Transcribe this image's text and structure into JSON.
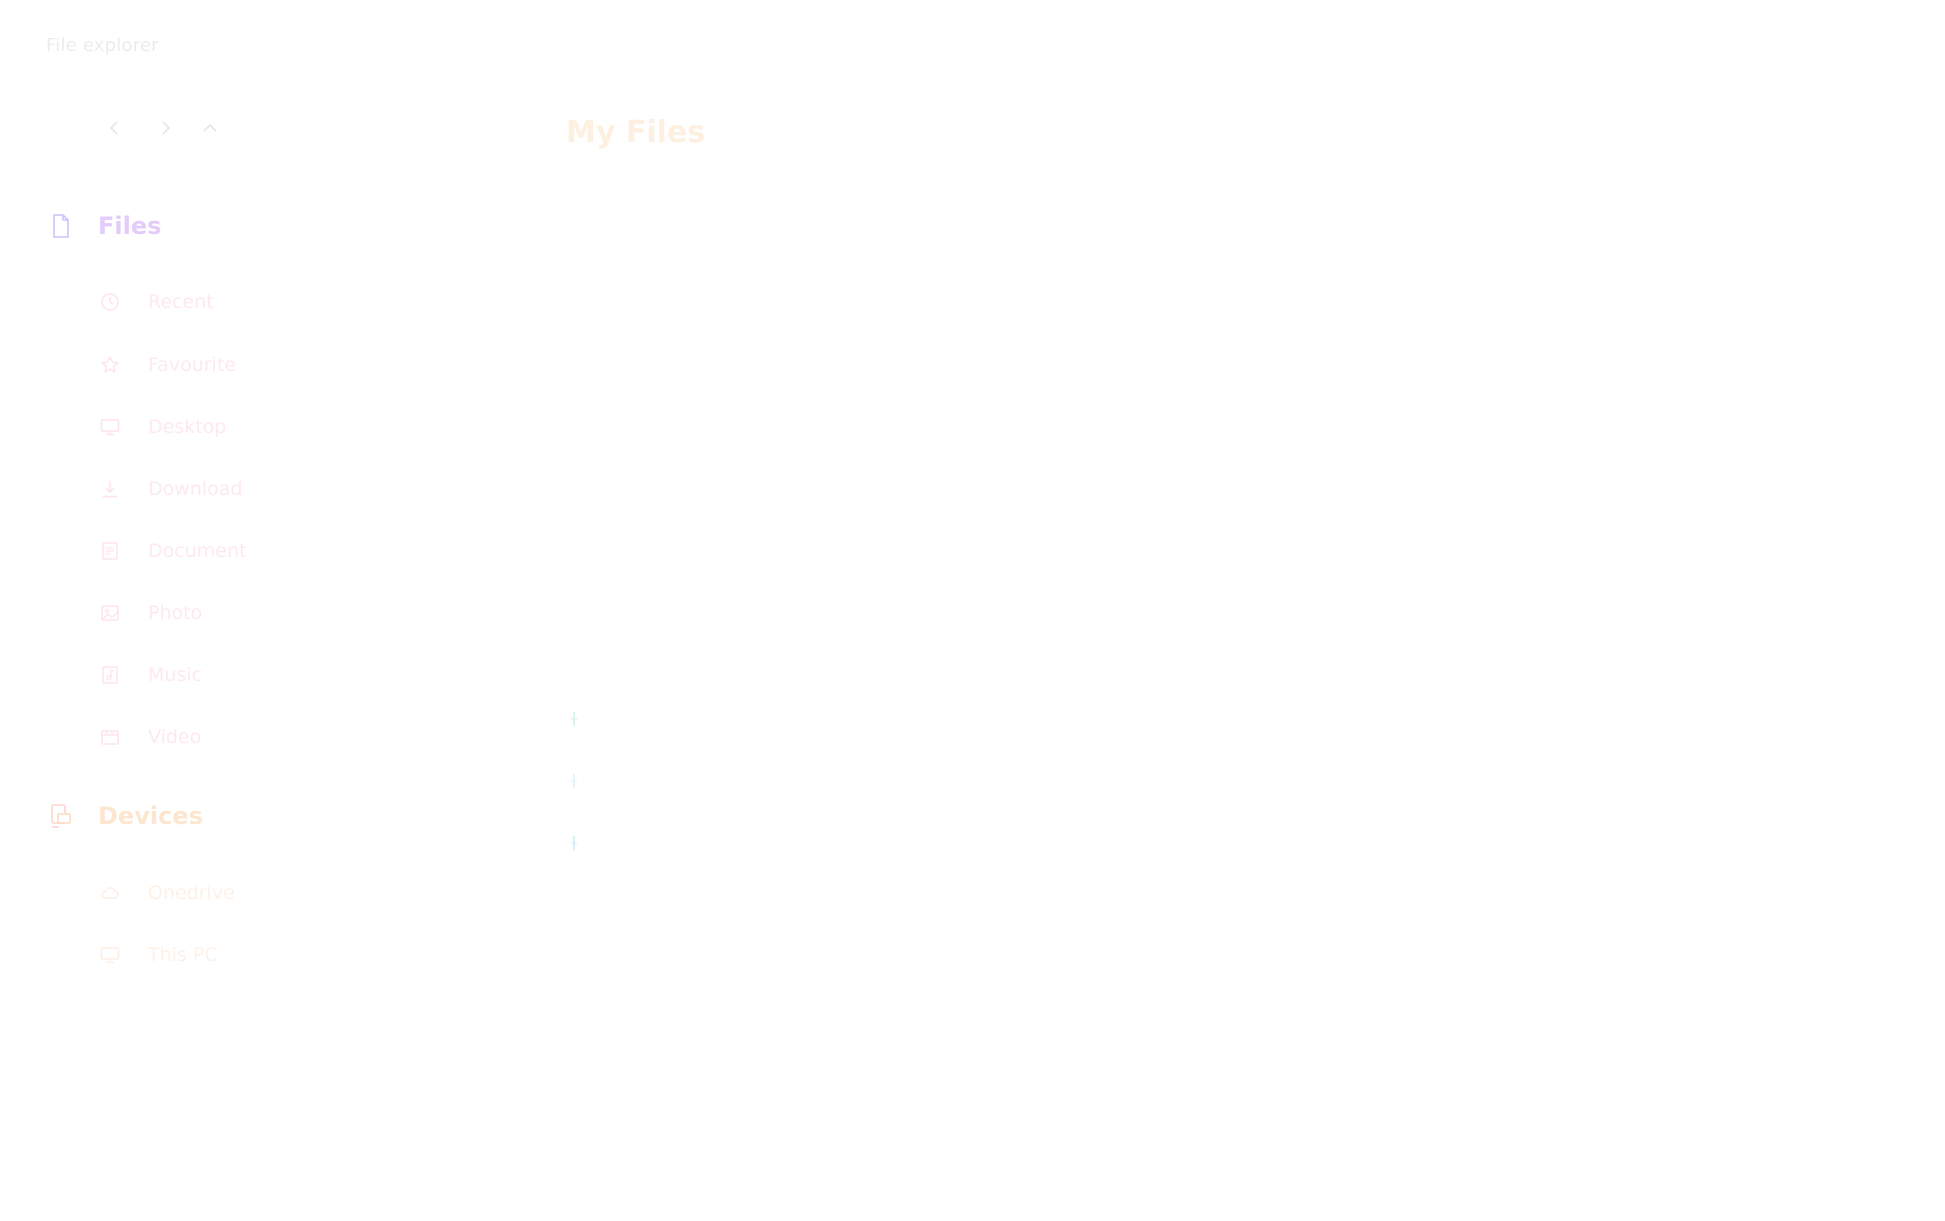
{
  "window": {
    "title": "File explorer"
  },
  "main": {
    "title": "My Files"
  },
  "sidebar": {
    "files_section": {
      "label": "Files",
      "icon": "file-icon"
    },
    "files_items": [
      {
        "label": "Recent",
        "icon": "clock-icon"
      },
      {
        "label": "Favourite",
        "icon": "star-icon"
      },
      {
        "label": "Desktop",
        "icon": "monitor-icon"
      },
      {
        "label": "Download",
        "icon": "download-icon"
      },
      {
        "label": "Document",
        "icon": "document-icon"
      },
      {
        "label": "Photo",
        "icon": "photo-icon"
      },
      {
        "label": "Music",
        "icon": "music-icon"
      },
      {
        "label": "Video",
        "icon": "video-icon"
      }
    ],
    "devices_section": {
      "label": "Devices",
      "icon": "devices-icon"
    },
    "devices_items": [
      {
        "label": "Onedrive",
        "icon": "cloud-icon"
      },
      {
        "label": "This PC",
        "icon": "pc-icon"
      }
    ]
  },
  "nav_icons": [
    "back-arrow-icon",
    "forward-arrow-icon",
    "up-arrow-icon"
  ],
  "colors": {
    "files_label": "#e3ccfa",
    "files_icon": "#c8c4fb",
    "item_text": "#fde9ef",
    "item_icon": "#fde4ea",
    "devices_label": "#fde6d0",
    "devices_icon": "#fcd6cc",
    "device_text": "#fdf1e8",
    "title_text": "#ececec",
    "page_title": "#fdf0e0",
    "list_marker": "#d8f6f0",
    "nav_arrows": "#e4e4f2"
  }
}
